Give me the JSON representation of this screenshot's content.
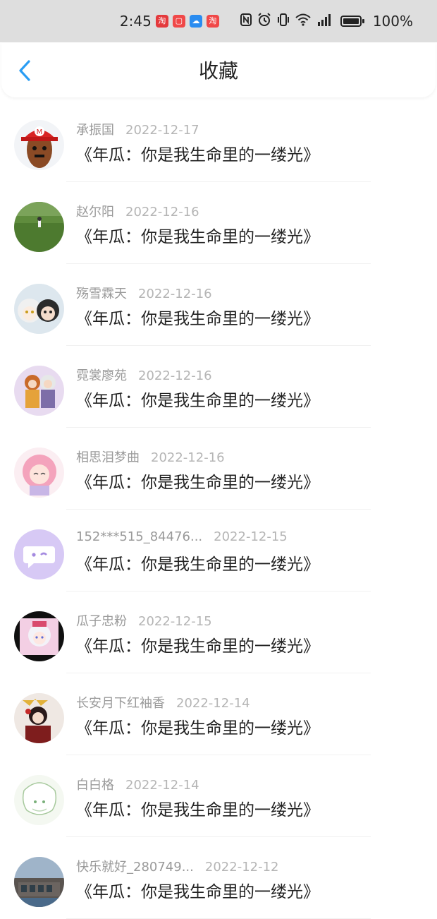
{
  "status_bar": {
    "time": "2:45",
    "battery_text": "100%",
    "app_badges": [
      {
        "name": "taobao-app-icon",
        "glyph": "淘",
        "color": "#e4393c"
      },
      {
        "name": "red-app-icon",
        "glyph": "▢",
        "color": "#f04848"
      },
      {
        "name": "cloud-app-icon",
        "glyph": "☁",
        "color": "#2a8cf0"
      },
      {
        "name": "deal-app-icon",
        "glyph": "淘",
        "color": "#f04848"
      }
    ],
    "icons": [
      "nfc-icon",
      "alarm-icon",
      "vibrate-icon",
      "wifi-icon",
      "signal-icon"
    ]
  },
  "nav": {
    "title": "收藏",
    "accent": "#2a9df4"
  },
  "favorites": [
    {
      "username": "承振国",
      "date": "2022-12-17",
      "title": "《年瓜：你是我生命里的一缕光》",
      "avatar": "mario-cap"
    },
    {
      "username": "赵尔阳",
      "date": "2022-12-16",
      "title": "《年瓜：你是我生命里的一缕光》",
      "avatar": "grass-field"
    },
    {
      "username": "殇雪霖天",
      "date": "2022-12-16",
      "title": "《年瓜：你是我生命里的一缕光》",
      "avatar": "anime-duo"
    },
    {
      "username": "霓裳廖苑",
      "date": "2022-12-16",
      "title": "《年瓜：你是我生命里的一缕光》",
      "avatar": "anime-couple"
    },
    {
      "username": "相思泪梦曲",
      "date": "2022-12-16",
      "title": "《年瓜：你是我生命里的一缕光》",
      "avatar": "pink-hair"
    },
    {
      "username": "152***515_84476...",
      "date": "2022-12-15",
      "title": "《年瓜：你是我生命里的一缕光》",
      "avatar": "default-chat"
    },
    {
      "username": "瓜子忠粉",
      "date": "2022-12-15",
      "title": "《年瓜：你是我生命里的一缕光》",
      "avatar": "anime-pink-bg"
    },
    {
      "username": "长安月下红袖香",
      "date": "2022-12-14",
      "title": "《年瓜：你是我生命里的一缕光》",
      "avatar": "anime-red"
    },
    {
      "username": "白白格",
      "date": "2022-12-14",
      "title": "《年瓜：你是我生命里的一缕光》",
      "avatar": "anime-white"
    },
    {
      "username": "快乐就好_280749...",
      "date": "2022-12-12",
      "title": "《年瓜：你是我生命里的一缕光》",
      "avatar": "building"
    }
  ]
}
